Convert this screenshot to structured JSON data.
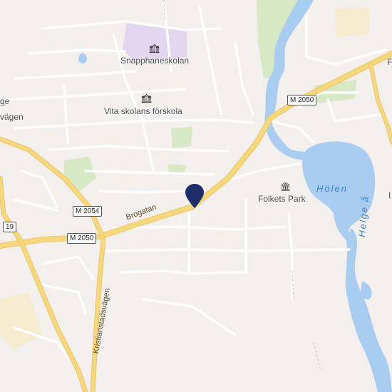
{
  "places": {
    "snapphaneskolan": "Snapphaneskolan",
    "vita_skolans_forskola": "Vita skolans förskola",
    "folkets_park": "Folkets Park"
  },
  "streets": {
    "brogatan": "Brogatan",
    "kristianstadsvagen": "Kristianstadsvägen",
    "edge_left_top": "ge",
    "edge_left_bottom": "vägen",
    "edge_right_top": "F",
    "edge_right_mid": "I"
  },
  "routes": {
    "m2054": "M 2054",
    "m2050_west": "M 2050",
    "m2050_east": "M 2050",
    "r19": "19"
  },
  "water": {
    "lake": "Hölen",
    "river": "Helge å"
  },
  "icons": {
    "school_icon": "school-icon",
    "museum_icon": "museum-icon",
    "location_pin": "location-pin-icon"
  },
  "colors": {
    "land": "#f2efec",
    "water": "#a8cdf0",
    "park": "#d6e8c4",
    "school_area": "#e2d5f0",
    "major_road": "#f6d77a",
    "pin": "#1f2d6b"
  }
}
